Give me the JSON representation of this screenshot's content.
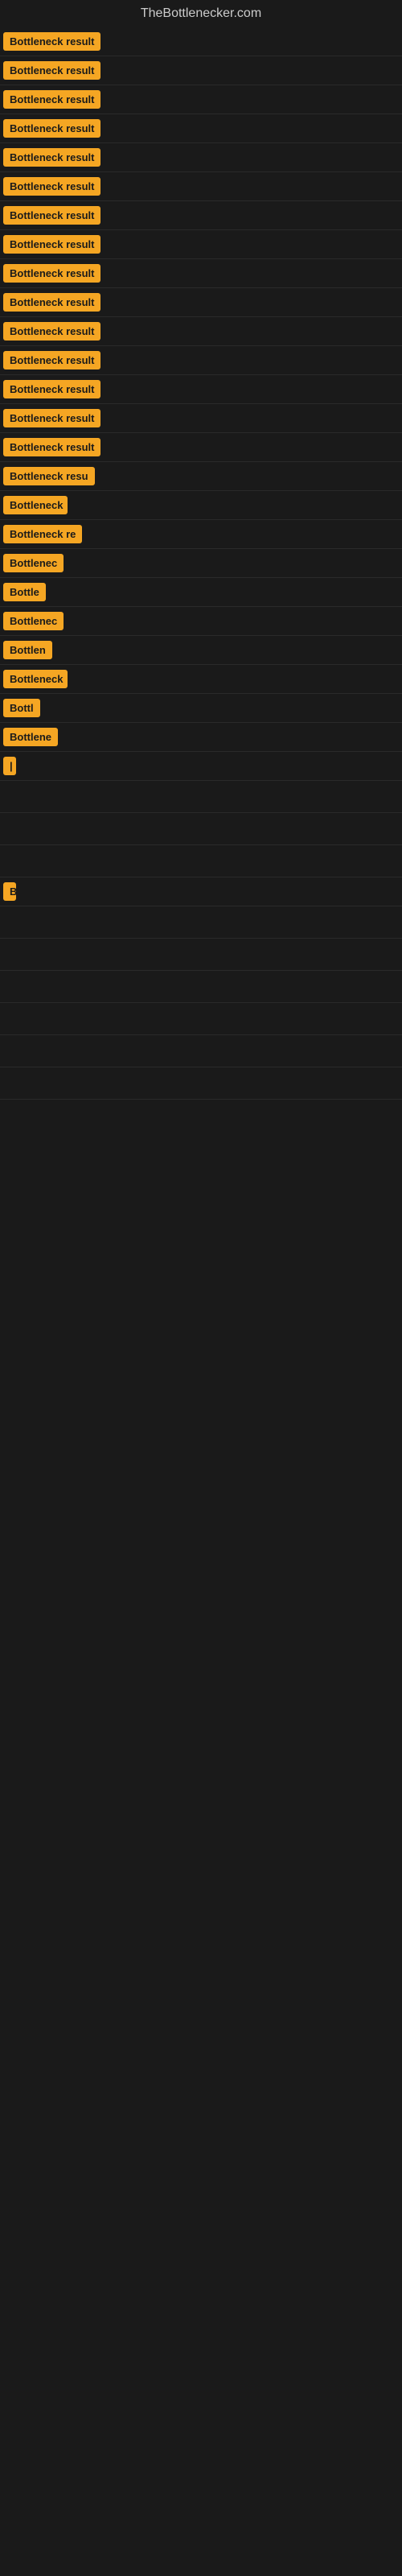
{
  "site": {
    "title": "TheBottlenecker.com"
  },
  "results": [
    {
      "label": "Bottleneck result",
      "width": 130
    },
    {
      "label": "Bottleneck result",
      "width": 130
    },
    {
      "label": "Bottleneck result",
      "width": 130
    },
    {
      "label": "Bottleneck result",
      "width": 130
    },
    {
      "label": "Bottleneck result",
      "width": 130
    },
    {
      "label": "Bottleneck result",
      "width": 130
    },
    {
      "label": "Bottleneck result",
      "width": 130
    },
    {
      "label": "Bottleneck result",
      "width": 130
    },
    {
      "label": "Bottleneck result",
      "width": 130
    },
    {
      "label": "Bottleneck result",
      "width": 130
    },
    {
      "label": "Bottleneck result",
      "width": 130
    },
    {
      "label": "Bottleneck result",
      "width": 130
    },
    {
      "label": "Bottleneck result",
      "width": 130
    },
    {
      "label": "Bottleneck result",
      "width": 130
    },
    {
      "label": "Bottleneck result",
      "width": 130
    },
    {
      "label": "Bottleneck resu",
      "width": 115
    },
    {
      "label": "Bottleneck",
      "width": 80
    },
    {
      "label": "Bottleneck re",
      "width": 100
    },
    {
      "label": "Bottlenec",
      "width": 75
    },
    {
      "label": "Bottle",
      "width": 55
    },
    {
      "label": "Bottlenec",
      "width": 75
    },
    {
      "label": "Bottlen",
      "width": 65
    },
    {
      "label": "Bottleneck",
      "width": 80
    },
    {
      "label": "Bottl",
      "width": 48
    },
    {
      "label": "Bottlene",
      "width": 70
    },
    {
      "label": "|",
      "width": 12
    },
    {
      "label": "",
      "width": 0
    },
    {
      "label": "",
      "width": 0
    },
    {
      "label": "",
      "width": 0
    },
    {
      "label": "B",
      "width": 14
    },
    {
      "label": "",
      "width": 0
    },
    {
      "label": "",
      "width": 0
    },
    {
      "label": "",
      "width": 0
    },
    {
      "label": "",
      "width": 0
    },
    {
      "label": "",
      "width": 0
    },
    {
      "label": "",
      "width": 0
    }
  ],
  "colors": {
    "badge_bg": "#f5a623",
    "page_bg": "#1a1a1a",
    "title_color": "#cccccc"
  }
}
